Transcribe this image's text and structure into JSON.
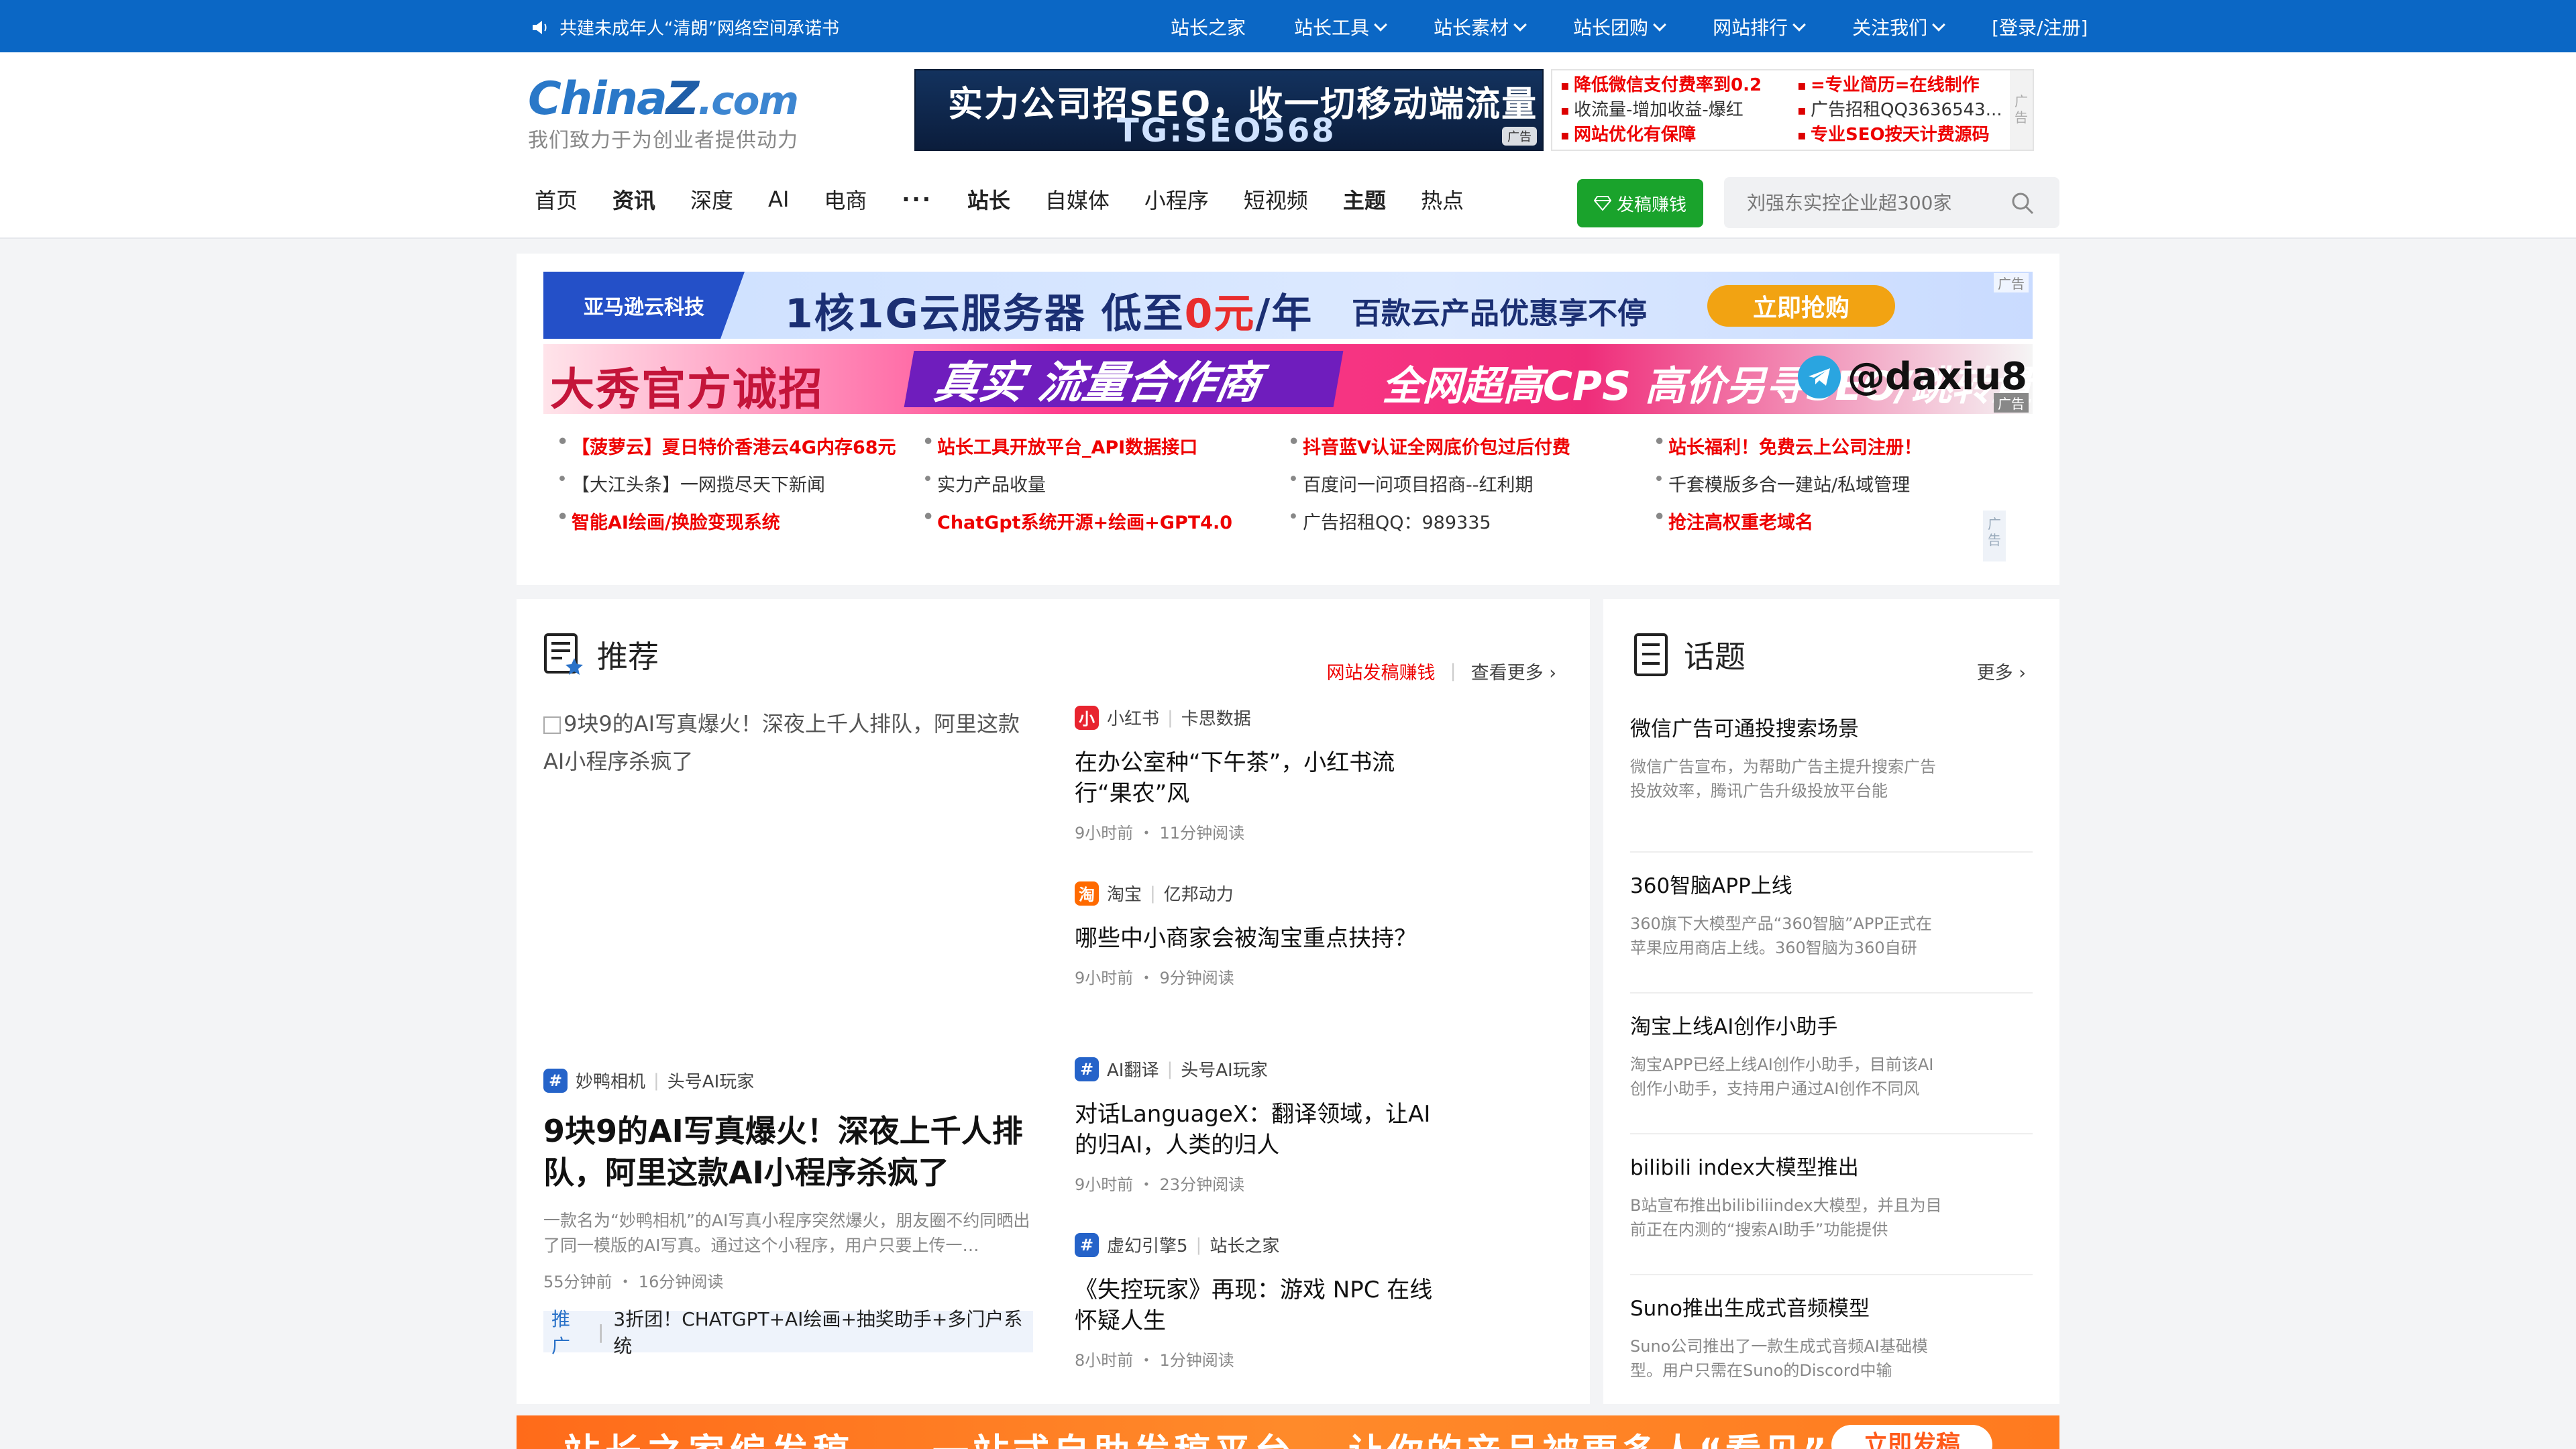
{
  "topbar": {
    "notice": "共建未成年人“清朗”网络空间承诺书",
    "items": [
      {
        "label": "站长之家",
        "dropdown": false
      },
      {
        "label": "站长工具",
        "dropdown": true
      },
      {
        "label": "站长素材",
        "dropdown": true
      },
      {
        "label": "站长团购",
        "dropdown": true
      },
      {
        "label": "网站排行",
        "dropdown": true
      },
      {
        "label": "关注我们",
        "dropdown": true
      },
      {
        "label": "[登录/注册]",
        "dropdown": false
      }
    ]
  },
  "logo": {
    "brand_a": "China",
    "brand_z": "Z",
    "brand_dom": ".com",
    "slogan": "我们致力于为创业者提供动力"
  },
  "header_banner": {
    "line1": "实力公司招SEO，收一切移动端流量",
    "line2": "TG:SEO568",
    "ad": "广告"
  },
  "header_ads": {
    "col1": [
      {
        "text": "降低微信支付费率到0.2",
        "red": true
      },
      {
        "text": "收流量-增加收益-爆红",
        "red": false
      },
      {
        "text": "网站优化有保障",
        "red": true
      }
    ],
    "col2": [
      {
        "text": "=专业简历=在线制作",
        "red": true
      },
      {
        "text": "广告招租QQ3636543...",
        "red": false
      },
      {
        "text": "专业SEO按天计费源码",
        "red": true
      }
    ],
    "side": "广告"
  },
  "main_nav": [
    {
      "label": "首页",
      "bold": false
    },
    {
      "label": "资讯",
      "bold": true
    },
    {
      "label": "深度",
      "bold": false
    },
    {
      "label": "AI",
      "bold": false
    },
    {
      "label": "电商",
      "bold": false
    },
    {
      "label": "···",
      "bold": true
    },
    {
      "label": "站长",
      "bold": true
    },
    {
      "label": "自媒体",
      "bold": false
    },
    {
      "label": "小程序",
      "bold": false
    },
    {
      "label": "短视频",
      "bold": false
    },
    {
      "label": "主题",
      "bold": true
    },
    {
      "label": "热点",
      "bold": false
    }
  ],
  "contribute_button": "发稿赚钱",
  "search": {
    "placeholder": "刘强东实控企业超300家"
  },
  "banner1": {
    "logo": "亚马逊云科技",
    "text_a": "1核1G云服务器 低至",
    "text_em": "0元",
    "text_b": "/年",
    "text2": "百款云产品优惠享不停",
    "button": "立即抢购",
    "ad": "广告"
  },
  "banner2": {
    "a": "大秀官方诚招",
    "b": "真实 流量合作商",
    "c": "全网超高CPS 高价另寻SEO/跳转量",
    "d": "@daxiu8",
    "ad": "广告"
  },
  "ad_links": [
    [
      {
        "text": "【菠萝云】夏日特价香港云4G内存68元",
        "red": true
      },
      {
        "text": "站长工具开放平台_API数据接口",
        "red": true
      },
      {
        "text": "抖音蓝V认证全网底价包过后付费",
        "red": true
      },
      {
        "text": "站长福利！免费云上公司注册！",
        "red": true
      }
    ],
    [
      {
        "text": "【大江头条】一网揽尽天下新闻",
        "red": false
      },
      {
        "text": "实力产品收量",
        "red": false
      },
      {
        "text": "百度问一问项目招商--红利期",
        "red": false
      },
      {
        "text": "千套模版多合一建站/私域管理",
        "red": false
      }
    ],
    [
      {
        "text": "智能AI绘画/换脸变现系统",
        "red": true
      },
      {
        "text": "ChatGpt系统开源+绘画+GPT4.0",
        "red": true
      },
      {
        "text": "广告招租QQ：989335",
        "red": false
      },
      {
        "text": "抢注高权重老域名",
        "red": true
      }
    ]
  ],
  "ad_links_side": "广告",
  "recommend": {
    "title": "推荐",
    "contribute": "网站发稿赚钱",
    "more": "查看更多",
    "big": {
      "img_alt": "9块9的AI写真爆火！深夜上千人排队，阿里这款AI小程序杀疯了",
      "source": "妙鸭相机",
      "author": "头号AI玩家",
      "title": "9块9的AI写真爆火！深夜上千人排队，阿里这款AI小程序杀疯了",
      "desc": "一款名为“妙鸭相机”的AI写真小程序突然爆火，朋友圈不约同晒出了同一模版的AI写真。通过这个小程序，用户只要上传一…",
      "time": "55分钟前 ・ 16分钟阅读",
      "promo_tag": "推广",
      "promo_text": "3折团！CHATGPT+AI绘画+抽奖助手+多门户系统"
    },
    "side": [
      {
        "source": "小红书",
        "author": "卡思数据",
        "icon_color": "#e8242f",
        "icon_text": "小",
        "title": "在办公室种“下午茶”，小红书流行“果农”风",
        "time": "9小时前 ・ 11分钟阅读"
      },
      {
        "source": "淘宝",
        "author": "亿邦动力",
        "icon_color": "#ff6a00",
        "icon_text": "淘",
        "title": "哪些中小商家会被淘宝重点扶持？",
        "time": "9小时前 ・ 9分钟阅读"
      },
      {
        "source": "AI翻译",
        "author": "头号AI玩家",
        "icon_color": "#2563c9",
        "icon_text": "#",
        "title": "对话LanguageX：翻译领域，让AI的归AI，人类的归人",
        "time": "9小时前 ・ 23分钟阅读"
      },
      {
        "source": "虚幻引擎5",
        "author": "站长之家",
        "icon_color": "#2563c9",
        "icon_text": "#",
        "title": "《失控玩家》再现：游戏 NPC 在线怀疑人生",
        "time": "8小时前 ・ 1分钟阅读"
      }
    ]
  },
  "topics": {
    "title": "话题",
    "more": "更多",
    "items": [
      {
        "title": "微信广告可通投搜索场景",
        "desc": "微信广告宣布，为帮助广告主提升搜索广告投放效率，腾讯广告升级投放平台能"
      },
      {
        "title": "360智脑APP上线",
        "desc": "360旗下大模型产品“360智脑”APP正式在苹果应用商店上线。360智脑为360自研"
      },
      {
        "title": "淘宝上线AI创作小助手",
        "desc": "淘宝APP已经上线AI创作小助手，目前该AI创作小助手，支持用户通过AI创作不同风"
      },
      {
        "title": "bilibili index大模型推出",
        "desc": "B站宣布推出bilibiliindex大模型，并且为目前正在内测的“搜索AI助手”功能提供"
      },
      {
        "title": "Suno推出生成式音频模型",
        "desc": "Suno公司推出了一款生成式音频AI基础模型。用户只需在Suno的Discord中输"
      }
    ]
  },
  "bottom_banner": {
    "a": "站长之家编发稿",
    "b": "一站式自助发稿平台",
    "c": "让你的产品被更多人“看见”",
    "button": "立即发稿"
  }
}
